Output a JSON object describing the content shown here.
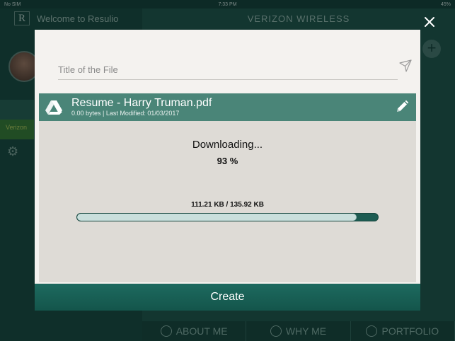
{
  "status_bar": {
    "carrier": "No SIM",
    "time": "7:33 PM",
    "battery": "45%"
  },
  "background_app": {
    "sidebar_title": "Welcome to Resulio",
    "sidebar_logo": "R",
    "header_title": "VERIZON WIRELESS",
    "sidebar_item": "Verizon",
    "tabs": [
      {
        "label": "ABOUT ME"
      },
      {
        "label": "WHY ME"
      },
      {
        "label": "PORTFOLIO"
      }
    ]
  },
  "modal": {
    "title_placeholder": "Title of the File",
    "file": {
      "name": "Resume - Harry Truman.pdf",
      "meta": "0.00 bytes | Last Modified: 01/03/2017"
    },
    "download": {
      "status": "Downloading...",
      "percent_text": "93 %",
      "size_text": "111.21 KB  / 135.92 KB",
      "progress_fraction": 0.93
    },
    "create_label": "Create"
  },
  "icons": {
    "close": "close-icon",
    "send": "send-icon",
    "drive": "google-drive-icon",
    "edit": "pencil-icon"
  },
  "colors": {
    "accent": "#4a8578",
    "button": "#1a6358",
    "progress_track": "#1d5c52",
    "progress_fill": "#c9dfdc"
  }
}
